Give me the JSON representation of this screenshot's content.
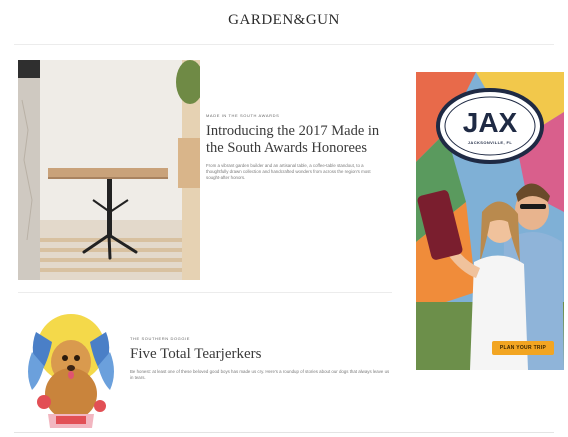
{
  "header": {
    "logo": "GARDEN&GUN"
  },
  "articles": [
    {
      "kicker": "MADE IN THE SOUTH AWARDS",
      "title": "Introducing the 2017 Made in the South Awards Honorees",
      "blurb": "From a vibrant garden builder and an artisanal table, a coffee-table standout, to a thoughtfully drawn collection and handcrafted wonders from across the region's most sought-after honors."
    },
    {
      "kicker": "THE SOUTHERN DOGGIE",
      "title": "Five Total Tearjerkers",
      "blurb": "Be honest: at least one of these beloved good boys has made us cry. Here's a roundup of stories about our dogs that always leave us in tears."
    }
  ],
  "ad": {
    "badge_text": "JAX",
    "badge_sub": "JACKSONVILLE, FL",
    "cta_label": "PLAN YOUR TRIP"
  },
  "colors": {
    "ad_cta": "#f2a522",
    "badge_ring": "#1f2a44"
  }
}
